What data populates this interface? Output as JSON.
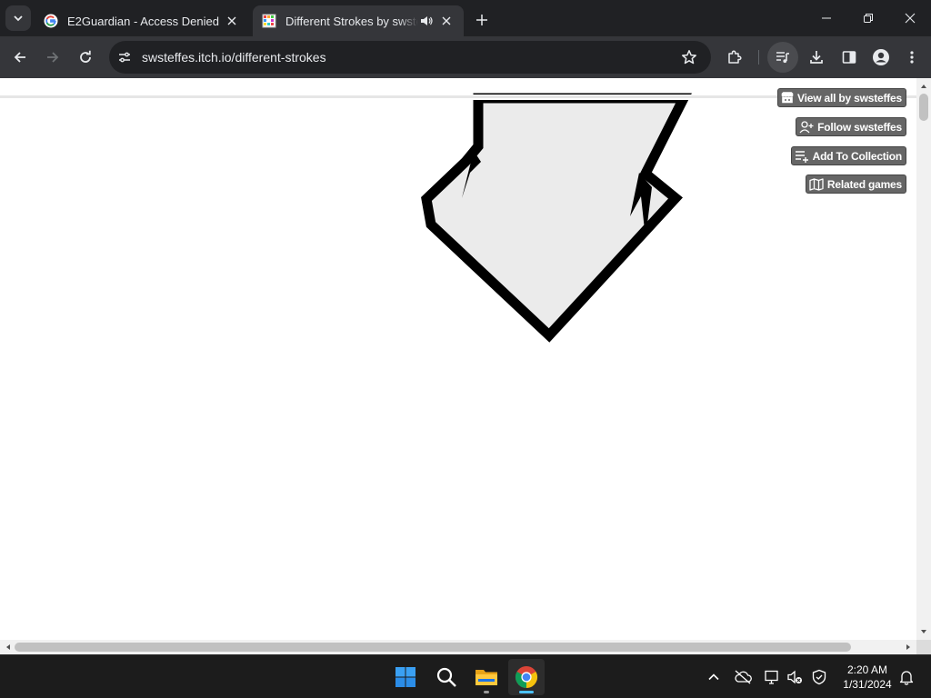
{
  "browser": {
    "tabs": [
      {
        "title": "E2Guardian - Access Denied",
        "favicon": "google-g-icon",
        "active": false
      },
      {
        "title": "Different Strokes by swsteffes",
        "favicon": "itch-game-icon",
        "active": true,
        "audio": true
      }
    ],
    "url": "swsteffes.itch.io/different-strokes"
  },
  "page": {
    "itch_buttons": [
      {
        "label": "View all by swsteffes",
        "icon": "itch-store-icon"
      },
      {
        "label": "Follow swsteffes",
        "icon": "add-user-icon"
      },
      {
        "label": "Add To Collection",
        "icon": "add-to-list-icon"
      },
      {
        "label": "Related games",
        "icon": "map-icon"
      }
    ]
  },
  "taskbar": {
    "time": "2:20 AM",
    "date": "1/31/2024"
  },
  "colors": {
    "browser_dark": "#202124",
    "toolbar": "#35363a",
    "itch_button": "#666666",
    "game_fill": "#ebebeb",
    "stroke": "#000000"
  }
}
